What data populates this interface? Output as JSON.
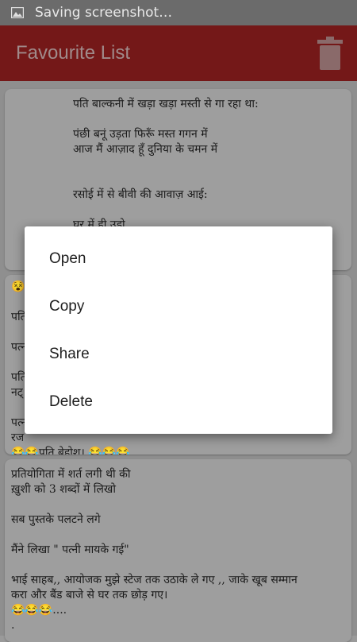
{
  "status_bar": {
    "notification_text": "Saving screenshot…"
  },
  "app_bar": {
    "title": "Favourite List",
    "delete_icon": "trash-icon"
  },
  "favourites": [
    {
      "text": "पति बाल्कनी में खड़ा खड़ा मस्ती से गा रहा था:\n\nपंछी बनूं उड़ता फिरूँ मस्त गगन में\nआज मैं आज़ाद हूँ दुनिया के चमन में\n\n\nरसोई में से बीवी की आवाज़ आई:\n\nघर में ही उड़ो,\nतुम्हारी मम्मी मायके गई है"
    },
    {
      "text": "😵😵\n\nपति\n\nपत्न\n\nपति\nनट्\n\nपत्न\nरज\n😂😂पति बेहोश। 😂😂😂"
    },
    {
      "text": "प्रतियोगिता में शर्त लगी थी की\nख़ुशी को 3 शब्दों में लिखो\n\nसब पुस्तके पलटने लगे\n\nमैंने लिखा \" पत्नी मायके गई\"\n\nभाई साहब,, आयोजक मुझे स्टेज तक उठाके ले गए ,, जाके खूब सम्मान\nकरा और बैंड बाजे से घर तक छोड़ गए।\n😂😂😂....\n.\n."
    }
  ],
  "context_menu": {
    "items": [
      "Open",
      "Copy",
      "Share",
      "Delete"
    ]
  },
  "colors": {
    "status_bar": "#6b6b6b",
    "app_bar": "#741818",
    "scrim_background": "#8f8f8f",
    "menu_background": "#ffffff"
  }
}
